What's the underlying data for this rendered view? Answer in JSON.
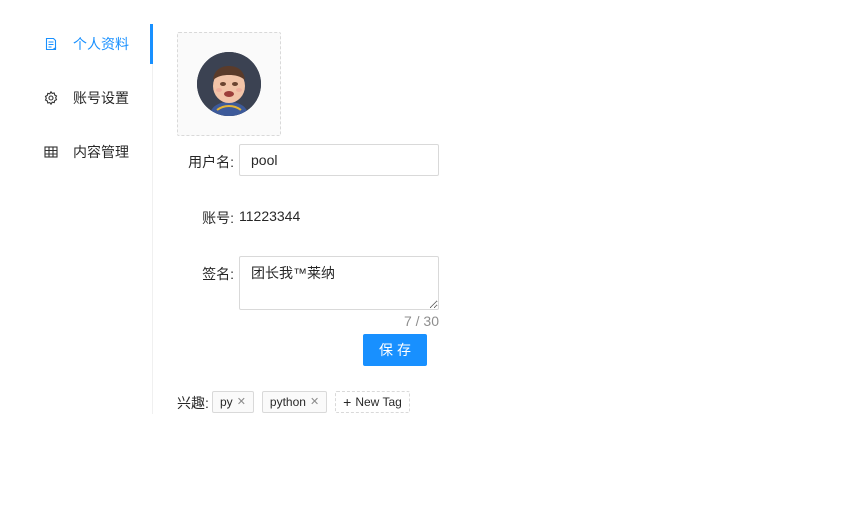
{
  "sidebar": {
    "items": [
      {
        "label": "个人资料",
        "icon": "profile-icon",
        "active": true
      },
      {
        "label": "账号设置",
        "icon": "gear-icon",
        "active": false
      },
      {
        "label": "内容管理",
        "icon": "table-icon",
        "active": false
      }
    ]
  },
  "form": {
    "username_label": "用户名:",
    "username_value": "pool",
    "account_label": "账号:",
    "account_value": "11223344",
    "signature_label": "签名:",
    "signature_value": "团长我™莱纳",
    "signature_counter": "7 / 30",
    "save_label": "保存"
  },
  "interests": {
    "label": "兴趣:",
    "tags": [
      "py",
      "python"
    ],
    "new_tag_label": "New Tag"
  },
  "colors": {
    "accent": "#1890ff",
    "border": "#d9d9d9"
  }
}
